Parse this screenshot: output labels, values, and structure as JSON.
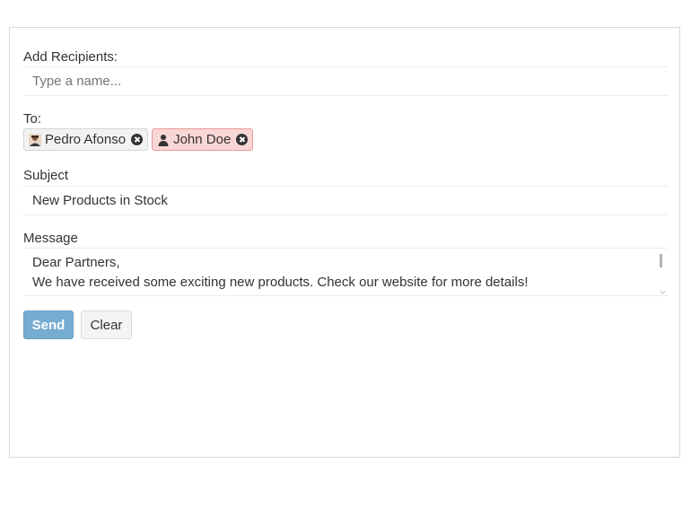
{
  "recipients": {
    "label": "Add Recipients:",
    "placeholder": "Type a name..."
  },
  "to": {
    "label": "To:",
    "chips": [
      {
        "name": "Pedro Afonso",
        "avatar_icon": "user-photo-icon",
        "selected": false
      },
      {
        "name": "John Doe",
        "avatar_icon": "user-icon",
        "selected": true
      }
    ]
  },
  "subject": {
    "label": "Subject",
    "value": "New Products in Stock"
  },
  "message": {
    "label": "Message",
    "lines": [
      "Dear Partners,",
      "We have received some exciting new products. Check our website for more details!"
    ]
  },
  "actions": {
    "send_label": "Send",
    "clear_label": "Clear"
  },
  "colors": {
    "send_button": "#77acd1",
    "selected_chip": "#f9d6d6"
  }
}
